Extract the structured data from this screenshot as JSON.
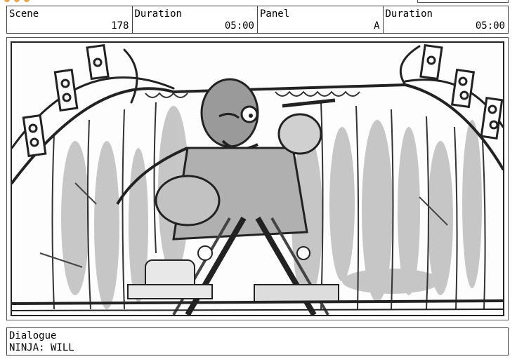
{
  "header": {
    "scene": {
      "label": "Scene",
      "value": "178"
    },
    "scene_duration": {
      "label": "Duration",
      "value": "05:00"
    },
    "panel": {
      "label": "Panel",
      "value": "A"
    },
    "panel_duration": {
      "label": "Duration",
      "value": "05:00"
    }
  },
  "dialogue": {
    "label": "Dialogue",
    "text": "NINJA: WILL"
  },
  "colors": {
    "logo_accent": "#f0a040",
    "border": "#444444",
    "sketch_dark": "#222222",
    "sketch_gray": "#a8a8a8"
  },
  "panel_image": {
    "icon": "storyboard-sketch"
  }
}
